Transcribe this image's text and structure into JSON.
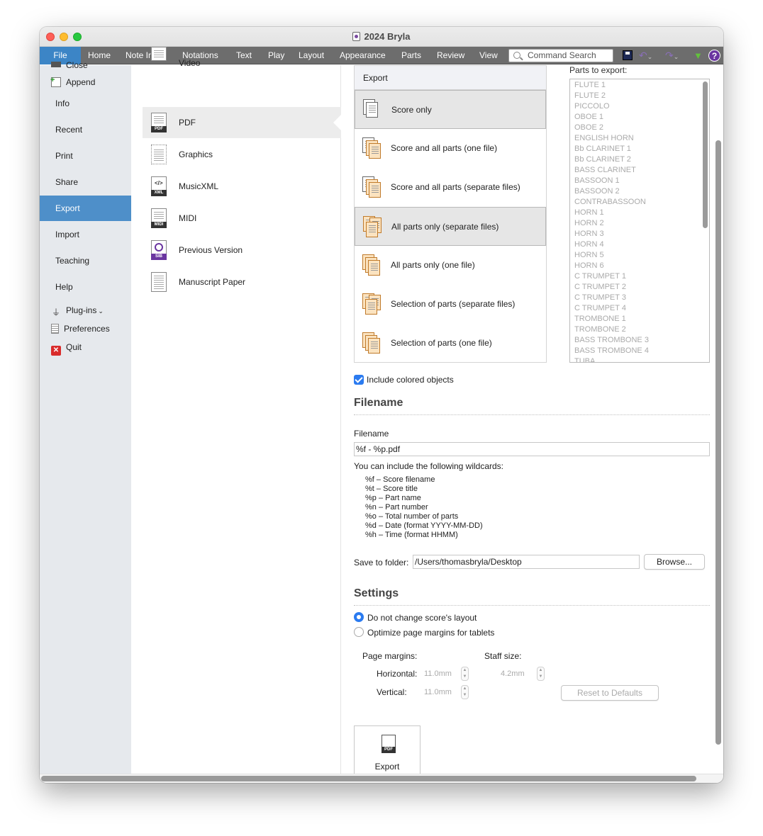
{
  "window": {
    "title": "2024 Bryla"
  },
  "ribbon": {
    "tabs": [
      "File",
      "Home",
      "Note Input",
      "Notations",
      "Text",
      "Play",
      "Layout",
      "Appearance",
      "Parts",
      "Review",
      "View"
    ],
    "search_placeholder": "Command Search"
  },
  "leftnav": {
    "partial_top": "Close",
    "append": "Append",
    "items": [
      "Info",
      "Recent",
      "Print",
      "Share",
      "Export",
      "Import",
      "Teaching",
      "Help"
    ],
    "plugins": "Plug-ins",
    "plugins_caret": "⌄",
    "preferences": "Preferences",
    "quit": "Quit"
  },
  "formats": {
    "partial_top": "Video",
    "items": [
      "PDF",
      "Graphics",
      "MusicXML",
      "MIDI",
      "Previous Version",
      "Manuscript Paper"
    ],
    "icon_tags": [
      "PDF",
      "",
      "XML",
      "MIDI",
      "SIB",
      ""
    ]
  },
  "export": {
    "header": "Export",
    "options": [
      "Score only",
      "Score and all parts (one file)",
      "Score and all parts (separate files)",
      "All parts only (separate files)",
      "All parts only (one file)",
      "Selection of parts (separate files)",
      "Selection of parts (one file)"
    ]
  },
  "parts": {
    "label": "Parts to export:",
    "list": [
      "FLUTE 1",
      "FLUTE 2",
      "PICCOLO",
      "OBOE 1",
      "OBOE 2",
      "ENGLISH HORN",
      "Bb CLARINET 1",
      "Bb CLARINET 2",
      "BASS CLARINET",
      "BASSOON 1",
      "BASSOON 2",
      "CONTRABASSOON",
      "HORN 1",
      "HORN 2",
      "HORN 3",
      "HORN 4",
      "HORN 5",
      "HORN 6",
      "C TRUMPET 1",
      "C TRUMPET 2",
      "C TRUMPET 3",
      "C TRUMPET 4",
      "TROMBONE 1",
      "TROMBONE 2",
      "BASS TROMBONE 3",
      "BASS TROMBONE 4",
      "TUBA"
    ]
  },
  "include_colored": {
    "label": "Include colored objects",
    "checked": true
  },
  "filename": {
    "section": "Filename",
    "label": "Filename",
    "value": "%f - %p.pdf",
    "wildcards_intro": "You can include the following wildcards:",
    "wildcards": [
      "%f – Score filename",
      "%t – Score title",
      "%p – Part name",
      "%n – Part number",
      "%o – Total number of parts",
      "%d – Date (format YYYY-MM-DD)",
      "%h – Time (format HHMM)"
    ],
    "folder_label": "Save to folder:",
    "folder_value": "/Users/thomasbryla/Desktop",
    "browse": "Browse..."
  },
  "settings": {
    "section": "Settings",
    "radio_1": "Do not change score's layout",
    "radio_2": "Optimize page margins for tablets",
    "selected": "radio_1",
    "page_margins": "Page margins:",
    "staff_size": "Staff size:",
    "horizontal": "Horizontal:",
    "vertical": "Vertical:",
    "horizontal_value": "11.0mm",
    "vertical_value": "11.0mm",
    "staff_value": "4.2mm",
    "reset": "Reset to Defaults"
  },
  "export_button": {
    "label": "Export",
    "tag": "PDF"
  },
  "colors": {
    "accent": "#3c85c6",
    "nav_active": "#4e8fc9",
    "ribbon": "#6d6d6d",
    "checkbox": "#2b7bf0"
  }
}
